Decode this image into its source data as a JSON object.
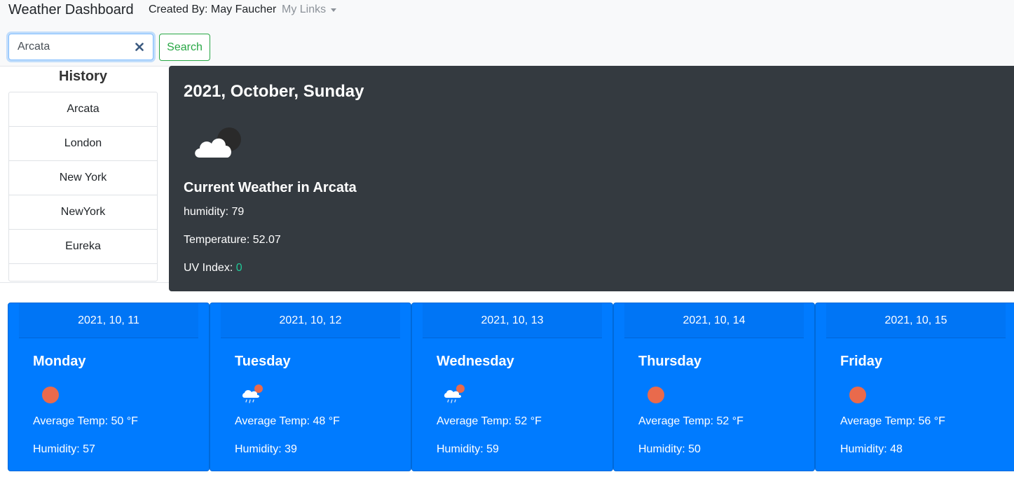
{
  "navbar": {
    "brand": "Weather Dashboard",
    "created_by": "Created By: May Faucher",
    "links_label": "My Links"
  },
  "search": {
    "value": "Arcata",
    "button_label": "Search"
  },
  "history": {
    "title": "History",
    "items": [
      "Arcata",
      "London",
      "New York",
      "NewYork",
      "Eureka",
      ""
    ]
  },
  "current": {
    "date": "2021, October, Sunday",
    "icon": "cloudy-night-icon",
    "title": "Current Weather in Arcata",
    "humidity": "humidity: 79",
    "temperature": "Temperature: 52.07",
    "uv_label": "UV Index: ",
    "uv_value": "0",
    "uv_color": "#20c997"
  },
  "forecast": [
    {
      "date": "2021, 10, 11",
      "day": "Monday",
      "icon": "sun-icon",
      "temp": "Average Temp: 50 °F",
      "humidity": "Humidity: 57"
    },
    {
      "date": "2021, 10, 12",
      "day": "Tuesday",
      "icon": "rain-sun-icon",
      "temp": "Average Temp: 48 °F",
      "humidity": "Humidity: 39"
    },
    {
      "date": "2021, 10, 13",
      "day": "Wednesday",
      "icon": "rain-sun-icon",
      "temp": "Average Temp: 52 °F",
      "humidity": "Humidity: 59"
    },
    {
      "date": "2021, 10, 14",
      "day": "Thursday",
      "icon": "sun-icon",
      "temp": "Average Temp: 52 °F",
      "humidity": "Humidity: 50"
    },
    {
      "date": "2021, 10, 15",
      "day": "Friday",
      "icon": "sun-icon",
      "temp": "Average Temp: 56 °F",
      "humidity": "Humidity: 48"
    }
  ],
  "colors": {
    "panel_dark": "#343a40",
    "card_blue": "#007bff",
    "search_green": "#28a745",
    "sun": "#e96a4c"
  }
}
